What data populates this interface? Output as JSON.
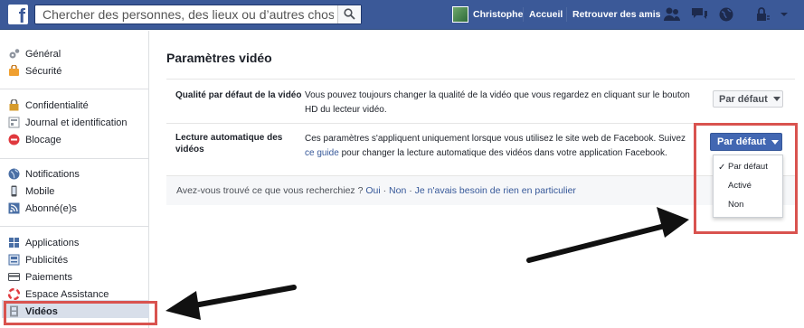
{
  "topbar": {
    "search_placeholder": "Chercher des personnes, des lieux ou d’autres choses",
    "user_name": "Christophe",
    "home": "Accueil",
    "find_friends": "Retrouver des amis",
    "brand_color": "#3b5998"
  },
  "sidebar": {
    "items": [
      {
        "label": "Général",
        "icon": "gear-icon"
      },
      {
        "label": "Sécurité",
        "icon": "security-badge-icon"
      },
      {
        "label": "Confidentialité",
        "icon": "lock-icon"
      },
      {
        "label": "Journal et identification",
        "icon": "timeline-icon"
      },
      {
        "label": "Blocage",
        "icon": "block-icon"
      },
      {
        "label": "Notifications",
        "icon": "globe-icon"
      },
      {
        "label": "Mobile",
        "icon": "mobile-icon"
      },
      {
        "label": "Abonné(e)s",
        "icon": "rss-icon"
      },
      {
        "label": "Applications",
        "icon": "apps-icon"
      },
      {
        "label": "Publicités",
        "icon": "ads-icon"
      },
      {
        "label": "Paiements",
        "icon": "card-icon"
      },
      {
        "label": "Espace Assistance",
        "icon": "lifebuoy-icon"
      },
      {
        "label": "Vidéos",
        "icon": "film-icon"
      }
    ]
  },
  "main": {
    "title": "Paramètres vidéo",
    "quality": {
      "label": "Qualité par défaut de la vidéo",
      "desc": "Vous pouvez toujours changer la qualité de la vidéo que vous regardez en cliquant sur le bouton HD du lecteur vidéo.",
      "value": "Par défaut"
    },
    "autoplay": {
      "label_line1": "Lecture automatique des",
      "label_line2": "vidéos",
      "desc_part1": "Ces paramètres s'appliquent uniquement lorsque vous utilisez le site web de Facebook. Suivez",
      "desc_link": "ce guide",
      "desc_part2": " pour changer la lecture automatique des vidéos dans votre application Facebook.",
      "value": "Par défaut",
      "options": [
        "Par défaut",
        "Activé",
        "Non"
      ],
      "selected_index": 0
    },
    "feedback": {
      "question": "Avez-vous trouvé ce que vous recherchiez ?",
      "yes": "Oui",
      "no": "Non",
      "other": "Je n'avais besoin de rien en particulier"
    }
  },
  "annotation_color": "#d9534f"
}
